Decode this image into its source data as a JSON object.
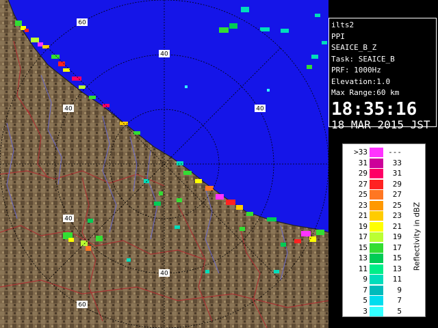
{
  "info": {
    "site": "ilts2",
    "mode": "PPI",
    "product": "SEAICE_B_Z",
    "task": "Task: SEAICE_B",
    "prf": "PRF: 1000Hz",
    "elevation": "Elevation:1.0",
    "max_range": "Max Range:60 km",
    "time": "18:35:16",
    "date": "18 MAR 2015 JST"
  },
  "range_labels": [
    "60",
    "40",
    "40",
    "40",
    "40",
    "40",
    "60"
  ],
  "legend": {
    "unit": "Reflectivity in dBZ",
    "rows": [
      {
        "lo": ">33",
        "hi": "---",
        "color": "#ff33ff"
      },
      {
        "lo": "31",
        "hi": "33",
        "color": "#cc0099"
      },
      {
        "lo": "29",
        "hi": "31",
        "color": "#ff0066"
      },
      {
        "lo": "27",
        "hi": "29",
        "color": "#ff2222"
      },
      {
        "lo": "25",
        "hi": "27",
        "color": "#ff7722"
      },
      {
        "lo": "23",
        "hi": "25",
        "color": "#ff9900"
      },
      {
        "lo": "21",
        "hi": "23",
        "color": "#ffcc00"
      },
      {
        "lo": "19",
        "hi": "21",
        "color": "#ffff00"
      },
      {
        "lo": "17",
        "hi": "19",
        "color": "#bbff33"
      },
      {
        "lo": "15",
        "hi": "17",
        "color": "#33dd33"
      },
      {
        "lo": "13",
        "hi": "15",
        "color": "#00cc55"
      },
      {
        "lo": "11",
        "hi": "13",
        "color": "#00ee88"
      },
      {
        "lo": "9",
        "hi": "11",
        "color": "#00ddbb"
      },
      {
        "lo": "7",
        "hi": "9",
        "color": "#00bbbb"
      },
      {
        "lo": "5",
        "hi": "7",
        "color": "#00ddee"
      },
      {
        "lo": "3",
        "hi": "5",
        "color": "#33ffff"
      }
    ]
  },
  "colors": {
    "sea": "#1515e8",
    "land": "#7a6448",
    "ring": "#000000",
    "boundary": "#aa3333",
    "river": "#6a6acc"
  }
}
